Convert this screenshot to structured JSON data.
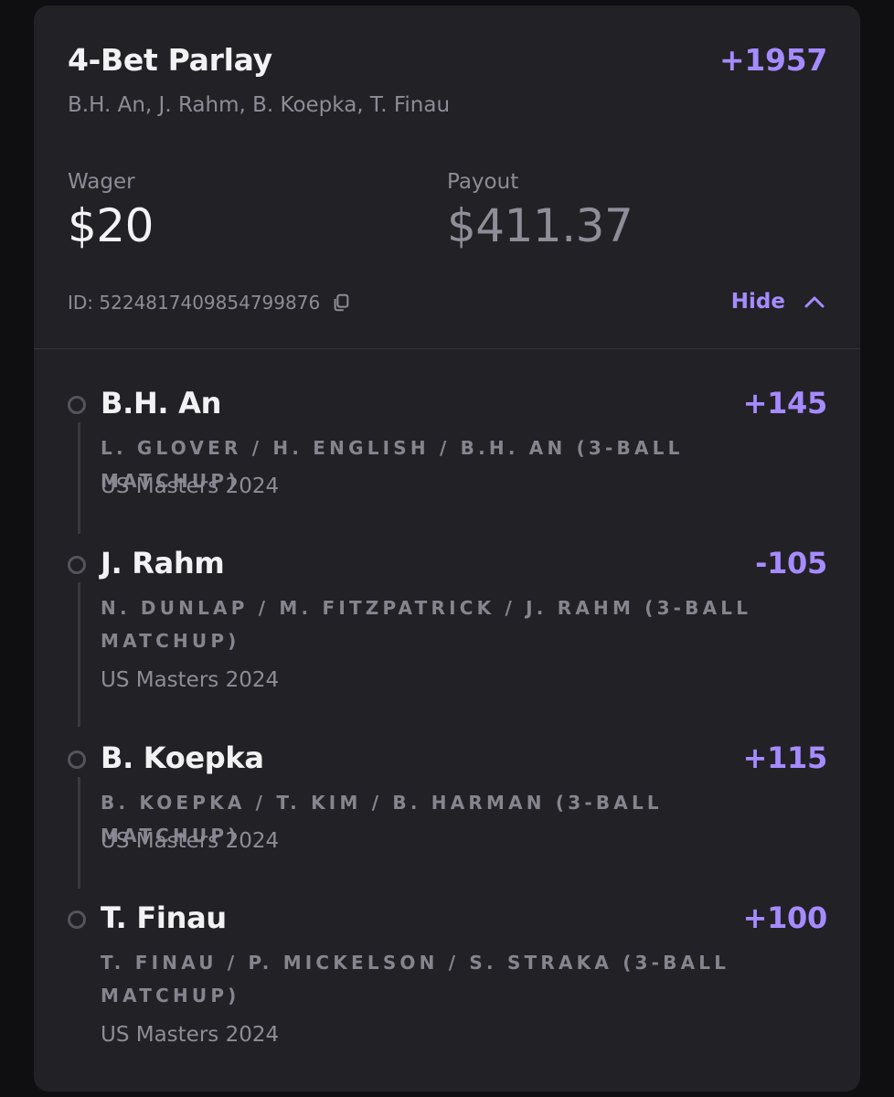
{
  "parlay": {
    "title": "4-Bet Parlay",
    "odds": "+1957",
    "selections": "B.H. An, J. Rahm, B. Koepka, T. Finau",
    "wager_label": "Wager",
    "wager_value": "$20",
    "payout_label": "Payout",
    "payout_value": "$411.37",
    "id_text": "ID: 5224817409854799876",
    "hide_label": "Hide"
  },
  "legs": [
    {
      "name": "B.H. An",
      "odds": "+145",
      "market": "L. GLOVER / H. ENGLISH / B.H. AN (3-BALL MATCHUP)",
      "event": "US Masters 2024"
    },
    {
      "name": "J. Rahm",
      "odds": "-105",
      "market": "N. DUNLAP / M. FITZPATRICK / J. RAHM (3-BALL MATCHUP)",
      "event": "US Masters 2024"
    },
    {
      "name": "B. Koepka",
      "odds": "+115",
      "market": "B. KOEPKA / T. KIM / B. HARMAN (3-BALL MATCHUP)",
      "event": "US Masters 2024"
    },
    {
      "name": "T. Finau",
      "odds": "+100",
      "market": "T. FINAU / P. MICKELSON / S. STRAKA (3-BALL MATCHUP)",
      "event": "US Masters 2024"
    }
  ],
  "colors": {
    "background": "#0f0f11",
    "card": "#222126",
    "accent": "#a58bff",
    "text_primary": "#f2f2f4",
    "text_secondary": "#8e8c96"
  },
  "icons": [
    "copy-icon",
    "chevron-up-icon",
    "leg-status-circle-icon"
  ]
}
